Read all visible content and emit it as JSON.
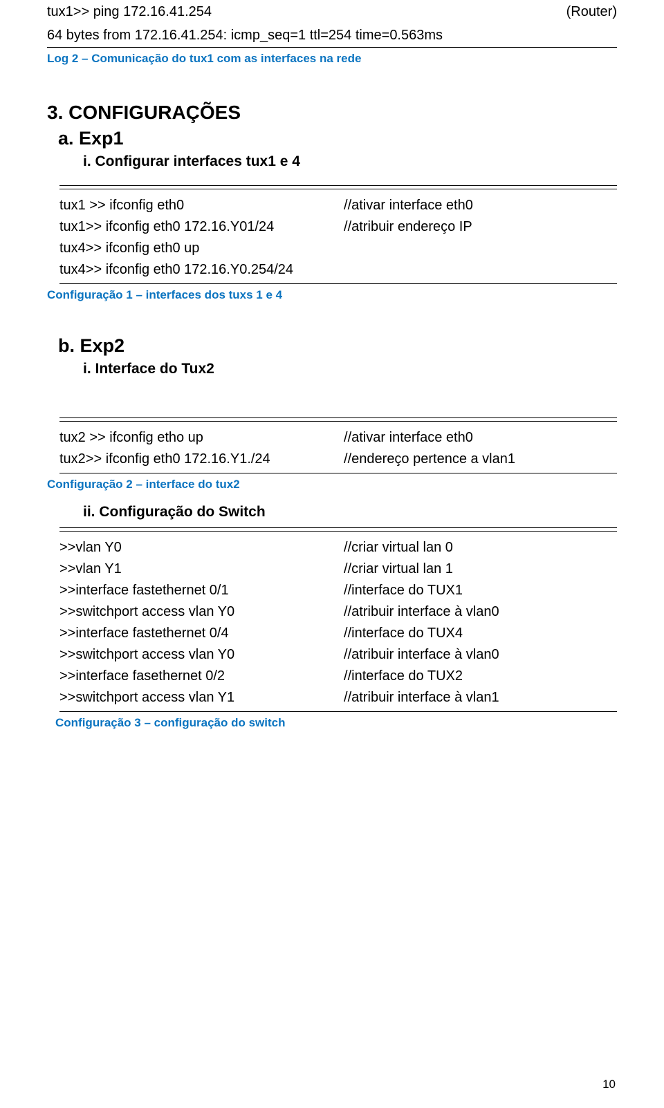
{
  "initial": {
    "row1_left": "tux1>> ping 172.16.41.254",
    "row1_right": "(Router)",
    "row2": "64 bytes from 172.16.41.254: icmp_seq=1 ttl=254 time=0.563ms",
    "caption": "Log 2 – Comunicação do tux1 com as interfaces na rede"
  },
  "sec3": {
    "heading": "3. CONFIGURAÇÕES",
    "a": {
      "heading": "a. Exp1",
      "i": "i.   Configurar interfaces tux1 e 4",
      "rows": [
        {
          "cmd": "tux1 >>  ifconfig eth0",
          "note": "//ativar interface eth0"
        },
        {
          "cmd": "tux1>>   ifconfig eth0 172.16.Y01/24",
          "note": "//atribuir endereço IP"
        },
        {
          "cmd": "tux4>>  ifconfig eth0 up",
          "note": ""
        },
        {
          "cmd": "tux4>>  ifconfig eth0 172.16.Y0.254/24",
          "note": ""
        }
      ],
      "caption": "Configuração 1 – interfaces dos tuxs 1 e 4"
    },
    "b": {
      "heading": "b. Exp2",
      "i": "i.   Interface do Tux2",
      "rows_i": [
        {
          "cmd": "tux2 >>  ifconfig etho up",
          "note": "//ativar interface eth0"
        },
        {
          "cmd": "tux2>>   ifconfig eth0 172.16.Y1./24",
          "note": "//endereço pertence a vlan1"
        }
      ],
      "caption_i": "Configuração 2 – interface do tux2",
      "ii": "ii.   Configuração do Switch",
      "rows_ii": [
        {
          "cmd": ">>vlan Y0",
          "note": "//criar virtual lan 0"
        },
        {
          "cmd": ">>vlan Y1",
          "note": "//criar virtual lan 1"
        },
        {
          "cmd": ">>interface fastethernet 0/1",
          "note": "//interface do TUX1"
        },
        {
          "cmd": ">>switchport access vlan Y0",
          "note": "//atribuir interface à vlan0"
        },
        {
          "cmd": ">>interface fastethernet 0/4",
          "note": "//interface do TUX4"
        },
        {
          "cmd": ">>switchport access vlan Y0",
          "note": "//atribuir interface à vlan0"
        },
        {
          "cmd": ">>interface fasethernet 0/2",
          "note": "//interface do TUX2"
        },
        {
          "cmd": ">>switchport access vlan Y1",
          "note": "//atribuir interface à vlan1"
        }
      ],
      "caption_ii": "Configuração 3 – configuração do switch"
    }
  },
  "page_number": "10"
}
